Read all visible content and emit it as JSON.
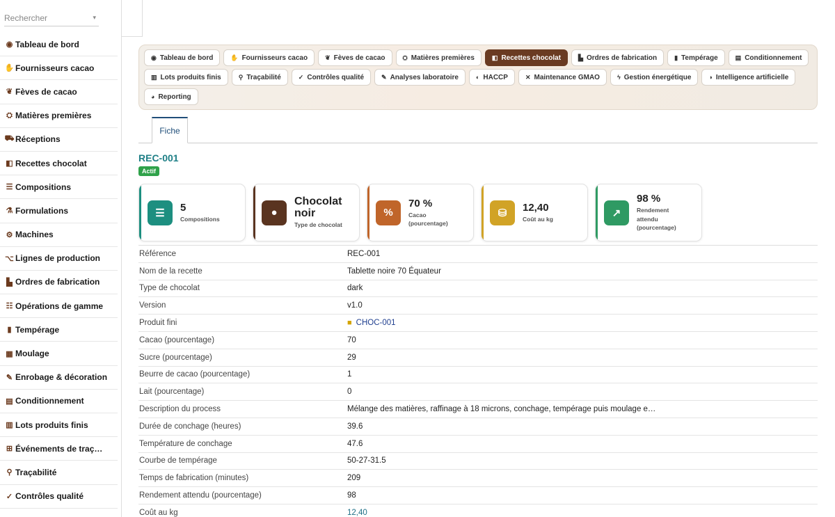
{
  "search": {
    "placeholder": "Rechercher",
    "caret": "▾"
  },
  "sidebar": {
    "items": [
      {
        "label": "Tableau de bord",
        "icon": "◉"
      },
      {
        "label": "Fournisseurs cacao",
        "icon": "✋"
      },
      {
        "label": "Fèves de cacao",
        "icon": "❦"
      },
      {
        "label": "Matières premières",
        "icon": "⛭"
      },
      {
        "label": "Réceptions",
        "icon": "⛟"
      },
      {
        "label": "Recettes chocolat",
        "icon": "◧"
      },
      {
        "label": "Compositions",
        "icon": "☰"
      },
      {
        "label": "Formulations",
        "icon": "⚗"
      },
      {
        "label": "Machines",
        "icon": "⚙"
      },
      {
        "label": "Lignes de production",
        "icon": "⌥"
      },
      {
        "label": "Ordres de fabrication",
        "icon": "▙"
      },
      {
        "label": "Opérations de gamme",
        "icon": "☷"
      },
      {
        "label": "Tempérage",
        "icon": "▮"
      },
      {
        "label": "Moulage",
        "icon": "▦"
      },
      {
        "label": "Enrobage & décoration",
        "icon": "✎"
      },
      {
        "label": "Conditionnement",
        "icon": "▤"
      },
      {
        "label": "Lots produits finis",
        "icon": "▥"
      },
      {
        "label": "Événements de traç…",
        "icon": "⊞"
      },
      {
        "label": "Traçabilité",
        "icon": "⚲"
      },
      {
        "label": "Contrôles qualité",
        "icon": "✓"
      }
    ]
  },
  "modules": [
    {
      "label": "Tableau de bord",
      "icon": "◉",
      "active": false
    },
    {
      "label": "Fournisseurs cacao",
      "icon": "✋",
      "active": false
    },
    {
      "label": "Fèves de cacao",
      "icon": "❦",
      "active": false
    },
    {
      "label": "Matières premières",
      "icon": "⛭",
      "active": false
    },
    {
      "label": "Recettes chocolat",
      "icon": "◧",
      "active": true
    },
    {
      "label": "Ordres de fabrication",
      "icon": "▙",
      "active": false
    },
    {
      "label": "Tempérage",
      "icon": "▮",
      "active": false
    },
    {
      "label": "Conditionnement",
      "icon": "▤",
      "active": false
    },
    {
      "label": "Lots produits finis",
      "icon": "▥",
      "active": false
    },
    {
      "label": "Traçabilité",
      "icon": "⚲",
      "active": false
    },
    {
      "label": "Contrôles qualité",
      "icon": "✓",
      "active": false
    },
    {
      "label": "Analyses laboratoire",
      "icon": "✎",
      "active": false
    },
    {
      "label": "HACCP",
      "icon": "◐",
      "active": false
    },
    {
      "label": "Maintenance GMAO",
      "icon": "✕",
      "active": false
    },
    {
      "label": "Gestion énergétique",
      "icon": "ϟ",
      "active": false
    },
    {
      "label": "Intelligence artificielle",
      "icon": "◑",
      "active": false
    },
    {
      "label": "Reporting",
      "icon": "◕",
      "active": false
    }
  ],
  "tabs": {
    "fiche": "Fiche"
  },
  "record": {
    "id": "REC-001",
    "status": "Actif"
  },
  "kpis": [
    {
      "value": "5",
      "label": "Compositions",
      "icon": "☰",
      "color": "#1d8f80"
    },
    {
      "value": "Chocolat noir",
      "label": "Type de chocolat",
      "icon": "●",
      "color": "#5a3420"
    },
    {
      "value": "70 %",
      "label": "Cacao (pourcentage)",
      "icon": "%",
      "color": "#c0652a"
    },
    {
      "value": "12,40",
      "label": "Coût au kg",
      "icon": "⛁",
      "color": "#d1a326"
    },
    {
      "value": "98 %",
      "label": "Rendement attendu (pourcentage)",
      "icon": "↗",
      "color": "#2f9a63"
    }
  ],
  "fields": [
    {
      "label": "Référence",
      "value": "REC-001"
    },
    {
      "label": "Nom de la recette",
      "value": "Tablette noire 70 Équateur"
    },
    {
      "label": "Type de chocolat",
      "value": "dark"
    },
    {
      "label": "Version",
      "value": "v1.0"
    },
    {
      "label": "Produit fini",
      "value": "CHOC-001"
    },
    {
      "label": "Cacao (pourcentage)",
      "value": "70"
    },
    {
      "label": "Sucre (pourcentage)",
      "value": "29"
    },
    {
      "label": "Beurre de cacao (pourcentage)",
      "value": "1"
    },
    {
      "label": "Lait (pourcentage)",
      "value": "0"
    },
    {
      "label": "Description du process",
      "value": "Mélange des matières, raffinage à 18 microns, conchage, tempérage puis moulage e…"
    },
    {
      "label": "Durée de conchage (heures)",
      "value": "39.6"
    },
    {
      "label": "Température de conchage",
      "value": "47.6"
    },
    {
      "label": "Courbe de tempérage",
      "value": "50-27-31.5"
    },
    {
      "label": "Temps de fabrication (minutes)",
      "value": "209"
    },
    {
      "label": "Rendement attendu (pourcentage)",
      "value": "98"
    },
    {
      "label": "Coût au kg",
      "value": "12,40"
    }
  ]
}
